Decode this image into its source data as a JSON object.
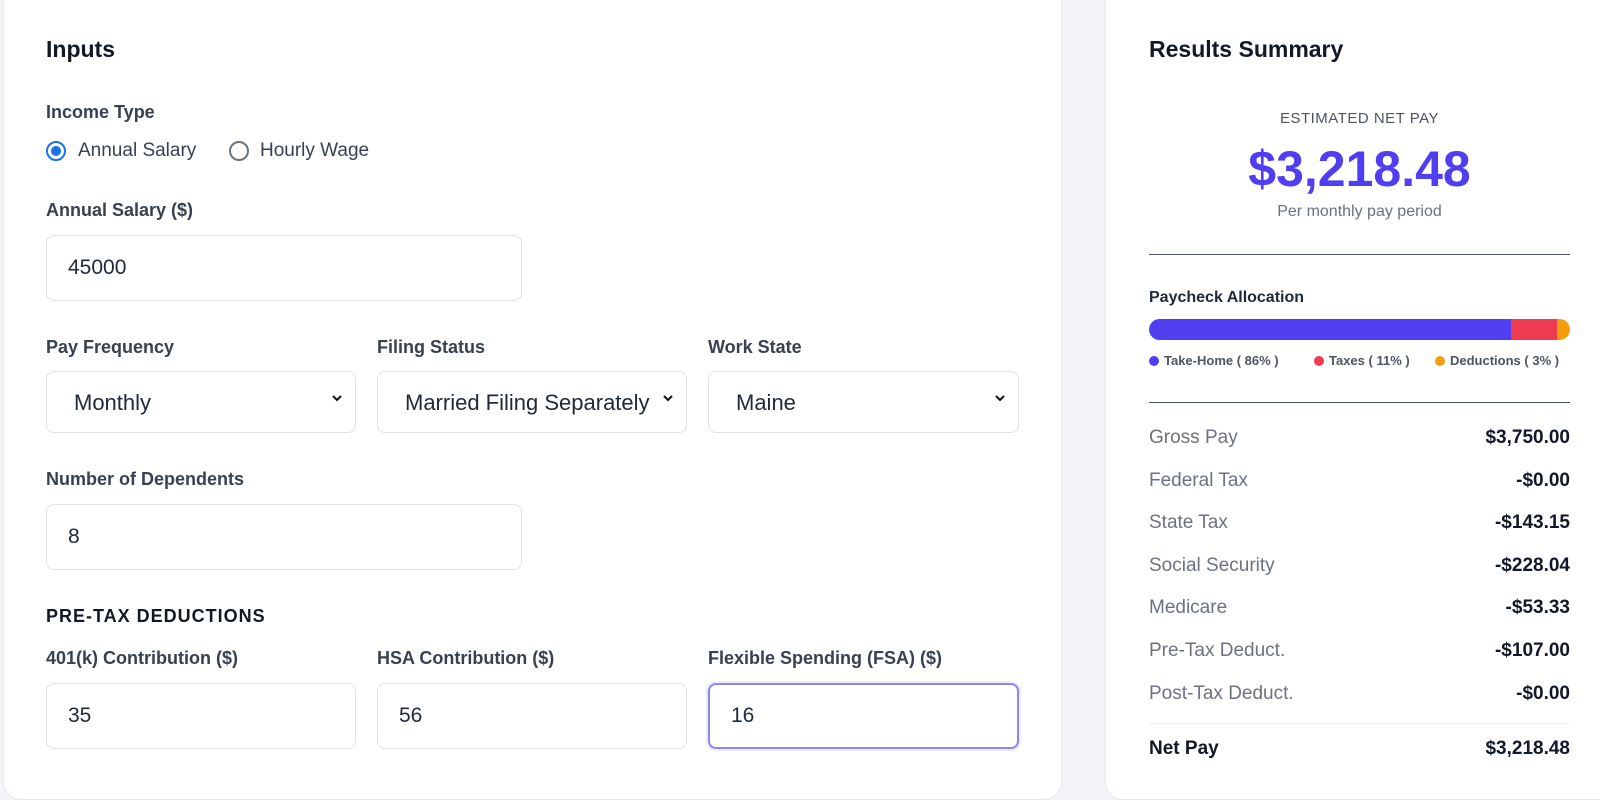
{
  "inputs": {
    "title": "Inputs",
    "income_type": {
      "label": "Income Type",
      "options": [
        "Annual Salary",
        "Hourly Wage"
      ],
      "selected": "Annual Salary"
    },
    "annual_salary": {
      "label": "Annual Salary ($)",
      "value": "45000"
    },
    "pay_frequency": {
      "label": "Pay Frequency",
      "value": "Monthly"
    },
    "filing_status": {
      "label": "Filing Status",
      "value": "Married Filing Separately"
    },
    "work_state": {
      "label": "Work State",
      "value": "Maine"
    },
    "dependents": {
      "label": "Number of Dependents",
      "value": "8"
    },
    "pretax": {
      "title": "PRE-TAX DEDUCTIONS",
      "k401": {
        "label": "401(k) Contribution ($)",
        "value": "35"
      },
      "hsa": {
        "label": "HSA Contribution ($)",
        "value": "56"
      },
      "fsa": {
        "label": "Flexible Spending (FSA) ($)",
        "value": "16"
      }
    }
  },
  "results": {
    "title": "Results Summary",
    "net_pay_caption": "ESTIMATED NET PAY",
    "net_pay_amount": "$3,218.48",
    "period_caption": "Per monthly pay period",
    "allocation": {
      "title": "Paycheck Allocation",
      "segments": [
        {
          "name": "Take-Home",
          "percent": 86,
          "color": "#4f3ff0",
          "legend": "Take-Home ( 86% )"
        },
        {
          "name": "Taxes",
          "percent": 11,
          "color": "#ef3b4f",
          "legend": "Taxes ( 11% )"
        },
        {
          "name": "Deductions",
          "percent": 3,
          "color": "#f59e0b",
          "legend": "Deductions ( 3% )"
        }
      ]
    },
    "rows": [
      {
        "label": "Gross Pay",
        "value": "$3,750.00"
      },
      {
        "label": "Federal Tax",
        "value": "-$0.00"
      },
      {
        "label": "State Tax",
        "value": "-$143.15"
      },
      {
        "label": "Social Security",
        "value": "-$228.04"
      },
      {
        "label": "Medicare",
        "value": "-$53.33"
      },
      {
        "label": "Pre-Tax Deduct.",
        "value": "-$107.00"
      },
      {
        "label": "Post-Tax Deduct.",
        "value": "-$0.00"
      }
    ],
    "net_row": {
      "label": "Net Pay",
      "value": "$3,218.48"
    }
  },
  "colors": {
    "accent": "#4f3ff0",
    "radio": "#1a73e8",
    "focus_border": "#8b87f0"
  }
}
